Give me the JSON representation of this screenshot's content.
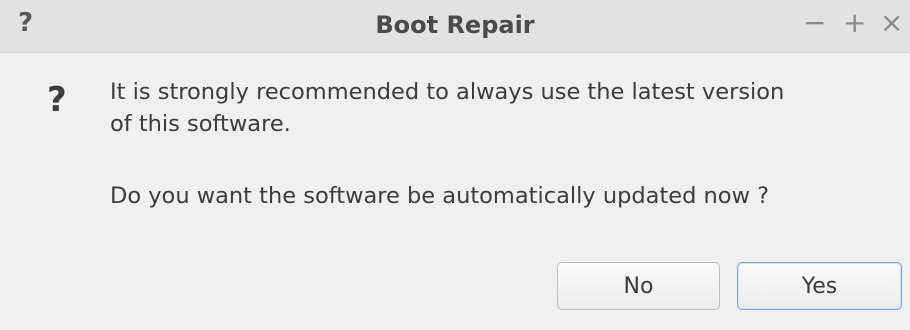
{
  "titlebar": {
    "help_glyph": "?",
    "title": "Boot Repair",
    "minimize_glyph": "−",
    "maximize_glyph": "+",
    "close_glyph": "×"
  },
  "dialog": {
    "icon_glyph": "?",
    "message_line1": "It is strongly recommended to always use the latest version",
    "message_line2": "of this software.",
    "question": "Do you want the software be automatically updated now ?"
  },
  "buttons": {
    "no_label": "No",
    "yes_label": "Yes"
  },
  "colors": {
    "background": "#f0f0f0",
    "titlebar": "#e2e2e2",
    "default_button_border": "#7ea7d8"
  }
}
